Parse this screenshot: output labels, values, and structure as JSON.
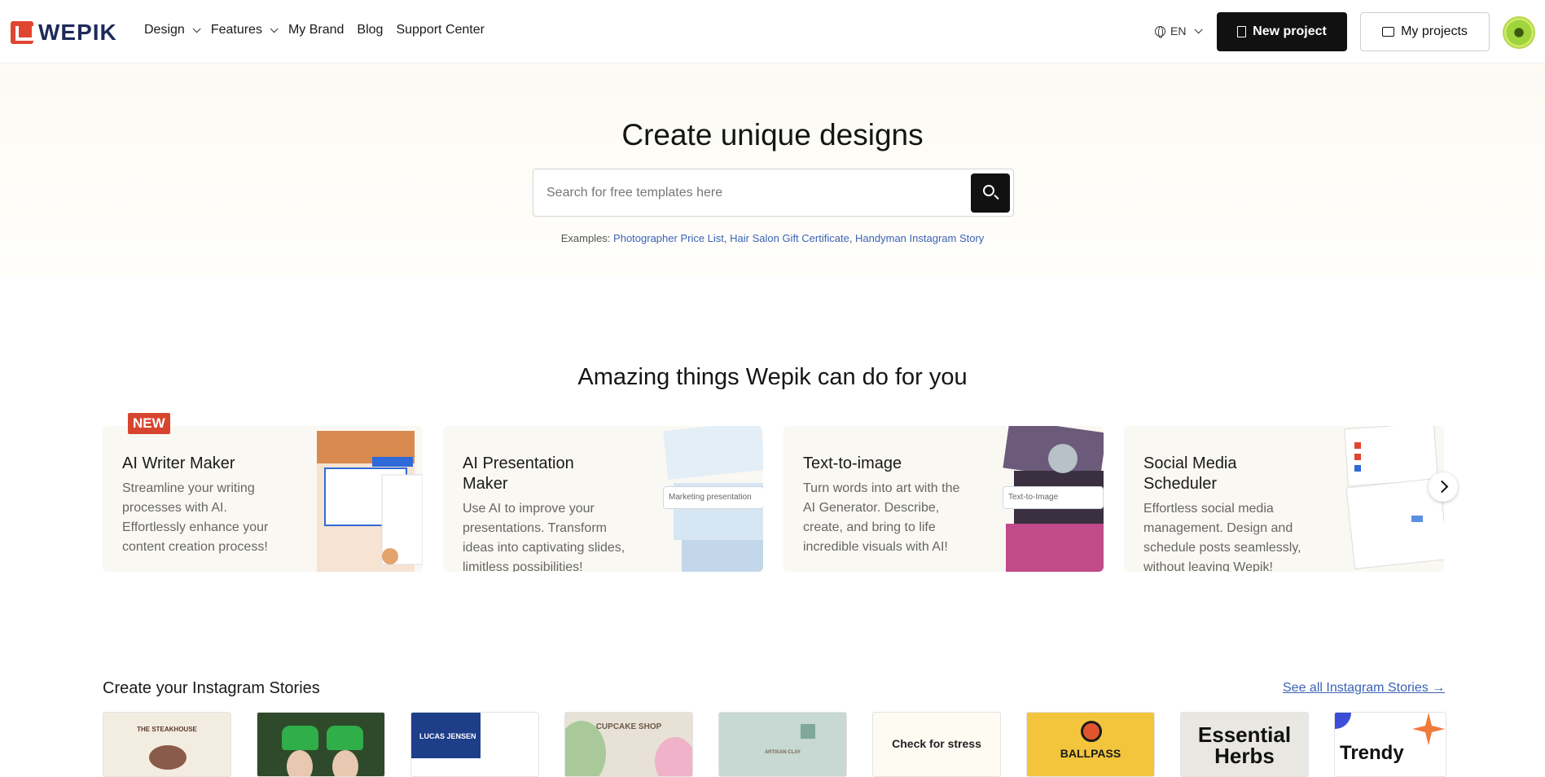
{
  "header": {
    "logo_text": "WEPIK",
    "nav": [
      "Design",
      "Features",
      "My Brand",
      "Blog",
      "Support Center"
    ],
    "lang": "EN",
    "new_project": "New project",
    "my_projects": "My projects"
  },
  "hero": {
    "title": "Create unique designs",
    "search_placeholder": "Search for free templates here",
    "examples_label": "Examples:",
    "examples": [
      "Photographer Price List",
      "Hair Salon Gift Certificate",
      "Handyman Instagram Story"
    ]
  },
  "features": {
    "title": "Amazing things Wepik can do for you",
    "badge": "NEW",
    "cards": [
      {
        "title": "AI Writer Maker",
        "desc": "Streamline your writing processes with AI. Effortlessly enhance your content creation process!"
      },
      {
        "title": "AI Presentation Maker",
        "desc": "Use AI to improve your presentations. Transform ideas into captivating slides, limitless possibilities!",
        "thumb_label": "Marketing presentation"
      },
      {
        "title": "Text-to-image",
        "desc": "Turn words into art with the AI Generator. Describe, create, and bring to life incredible visuals with AI!",
        "thumb_label": "Text-to-Image"
      },
      {
        "title": "Social Media Scheduler",
        "desc": "Effortless social media management. Design and schedule posts seamlessly, without leaving Wepik!"
      }
    ]
  },
  "stories": {
    "title": "Create your Instagram Stories",
    "see_all": "See all Instagram Stories →",
    "items": [
      {
        "label": "THE STEAKHOUSE",
        "bg": "#f3ece1",
        "color": "#5b3a2a"
      },
      {
        "label": "",
        "bg": "#2f4a2a",
        "color": "#ffffff"
      },
      {
        "label": "LUCAS JENSEN",
        "bg": "#ffffff",
        "color": "#ffffff"
      },
      {
        "label": "CUPCAKE SHOP",
        "bg": "#e8e2d6",
        "color": "#6b5a4a"
      },
      {
        "label": "ARTISAN CLAY",
        "bg": "#c8d8d2",
        "color": "#7a6a5a"
      },
      {
        "label": "Check for stress",
        "bg": "#fdfbf2",
        "color": "#222222"
      },
      {
        "label": "BALLPASS",
        "bg": "#f2c53d",
        "color": "#1a1a1a"
      },
      {
        "label": "Essential Herbs",
        "bg": "#e9e7e1",
        "color": "#111111"
      },
      {
        "label": "Trendy",
        "bg": "#ffffff",
        "color": "#111111"
      }
    ]
  }
}
